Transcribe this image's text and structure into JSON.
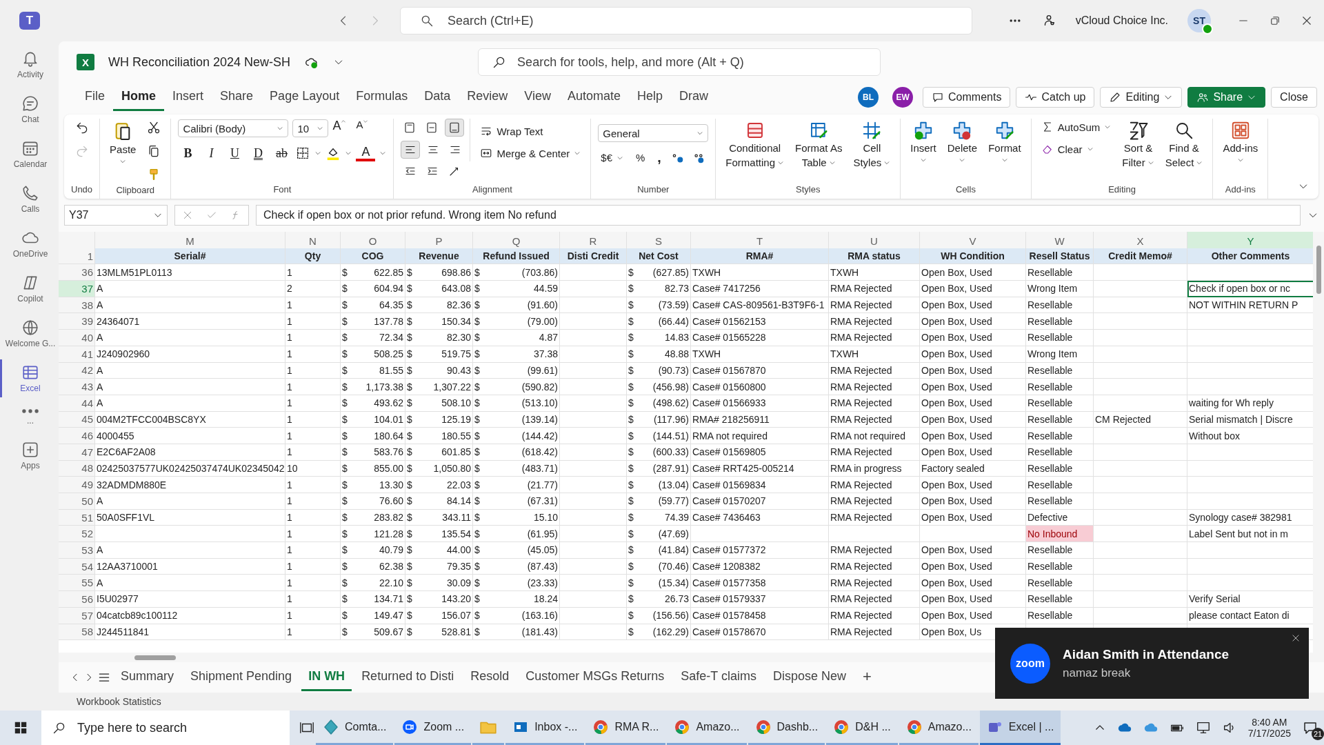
{
  "teams": {
    "logo": "T",
    "search": {
      "placeholder": "Search (Ctrl+E)"
    },
    "org": "vCloud Choice Inc.",
    "avatar": "ST"
  },
  "rail": [
    {
      "label": "Activity",
      "kind": "bell",
      "selected": false
    },
    {
      "label": "Chat",
      "kind": "chat",
      "selected": false
    },
    {
      "label": "Calendar",
      "kind": "calendar",
      "selected": false
    },
    {
      "label": "Calls",
      "kind": "phone",
      "selected": false
    },
    {
      "label": "OneDrive",
      "kind": "cloud",
      "selected": false
    },
    {
      "label": "Copilot",
      "kind": "copilot",
      "selected": false
    },
    {
      "label": "Welcome G...",
      "kind": "welcome",
      "selected": false
    },
    {
      "label": "Excel",
      "kind": "excel",
      "selected": true
    },
    {
      "label": "...",
      "kind": "more",
      "selected": false
    },
    {
      "label": "Apps",
      "kind": "apps",
      "selected": false
    }
  ],
  "excel": {
    "app_icon": "X",
    "title": "WH Reconciliation 2024 New-SH",
    "search": {
      "placeholder": "Search for tools, help, and more (Alt + Q)"
    },
    "menu": [
      {
        "label": "File",
        "selected": false
      },
      {
        "label": "Home",
        "selected": true
      },
      {
        "label": "Insert",
        "selected": false
      },
      {
        "label": "Share",
        "selected": false
      },
      {
        "label": "Page Layout",
        "selected": false
      },
      {
        "label": "Formulas",
        "selected": false
      },
      {
        "label": "Data",
        "selected": false
      },
      {
        "label": "Review",
        "selected": false
      },
      {
        "label": "View",
        "selected": false
      },
      {
        "label": "Automate",
        "selected": false
      },
      {
        "label": "Help",
        "selected": false
      },
      {
        "label": "Draw",
        "selected": false
      }
    ],
    "collaborators": [
      {
        "initials": "BL",
        "color": "#0f6cbd"
      },
      {
        "initials": "EW",
        "color": "#8a1fa8"
      }
    ],
    "buttons": [
      {
        "label": "Comments",
        "kind": "comments"
      },
      {
        "label": "Catch up",
        "kind": "catchup"
      },
      {
        "label": "Editing",
        "kind": "editing"
      },
      {
        "label": "Share",
        "kind": "share"
      },
      {
        "label": "Close",
        "kind": "close"
      }
    ]
  },
  "ribbon": {
    "undo": {
      "group": "Undo"
    },
    "clipboard": {
      "paste": "Paste",
      "group": "Clipboard"
    },
    "font": {
      "name": "Calibri (Body)",
      "size": "10",
      "grow": "A",
      "shrink": "A",
      "styles": [
        "B",
        "I",
        "U",
        "D",
        "ab"
      ],
      "color_letter": "A",
      "group": "Font"
    },
    "alignment": {
      "wrap": "Wrap Text",
      "merge": "Merge & Center",
      "group": "Alignment"
    },
    "number": {
      "format": "General",
      "currency": "$€",
      "percent": "%",
      "comma": ",",
      "group": "Number"
    },
    "styles": {
      "buttons": [
        {
          "lines": [
            "Conditional",
            "Formatting"
          ],
          "kind": "conditional"
        },
        {
          "lines": [
            "Format As",
            "Table"
          ],
          "kind": "table"
        },
        {
          "lines": [
            "Cell",
            "Styles"
          ],
          "kind": "cellstyles"
        }
      ],
      "group": "Styles"
    },
    "cells": {
      "buttons": [
        {
          "label": "Insert",
          "kind": "insert"
        },
        {
          "label": "Delete",
          "kind": "delete"
        },
        {
          "label": "Format",
          "kind": "format"
        }
      ],
      "group": "Cells"
    },
    "editing": {
      "autosum": "AutoSum",
      "clear": "Clear",
      "sort": [
        "Sort &",
        "Filter"
      ],
      "find": [
        "Find &",
        "Select"
      ],
      "group": "Editing"
    },
    "addins": {
      "button": "Add-ins",
      "group": "Add-ins"
    }
  },
  "formula_bar": {
    "name_box": "Y37",
    "formula": "Check if open box or not prior refund. Wrong item No refund"
  },
  "sheet": {
    "columns": [
      {
        "letter": "M",
        "selected": false
      },
      {
        "letter": "N",
        "selected": false
      },
      {
        "letter": "O",
        "selected": false
      },
      {
        "letter": "P",
        "selected": false
      },
      {
        "letter": "Q",
        "selected": false
      },
      {
        "letter": "R",
        "selected": false
      },
      {
        "letter": "S",
        "selected": false
      },
      {
        "letter": "T",
        "selected": false
      },
      {
        "letter": "U",
        "selected": false
      },
      {
        "letter": "V",
        "selected": false
      },
      {
        "letter": "W",
        "selected": false
      },
      {
        "letter": "X",
        "selected": false
      },
      {
        "letter": "Y",
        "selected": true
      }
    ],
    "header_row": {
      "row": "1",
      "cells": [
        "Serial#",
        "Qty",
        "COG",
        "Revenue",
        "Refund Issued",
        "Disti Credit",
        "Net Cost",
        "RMA#",
        "RMA status",
        "WH Condition",
        "Resell Status",
        "Credit Memo#",
        "Other Comments"
      ]
    },
    "rows": [
      {
        "row": "36",
        "selected": false,
        "serial": "13MLM51PL0113",
        "qty": "1",
        "cog": [
          "$",
          "622.85"
        ],
        "revenue": [
          "$",
          "698.86"
        ],
        "refund": [
          "$",
          "(703.86)"
        ],
        "net": [
          "$",
          "(627.85)"
        ],
        "rma": "TXWH",
        "rma_status": "TXWH",
        "wh_condition": "Open Box, Used",
        "resell": "Resellable",
        "resell_flagged": false
      },
      {
        "row": "37",
        "selected": true,
        "serial": "A",
        "qty": "2",
        "cog": [
          "$",
          "604.94"
        ],
        "revenue": [
          "$",
          "643.08"
        ],
        "refund": [
          "$",
          "44.59"
        ],
        "net": [
          "$",
          "82.73"
        ],
        "rma": "Case# 7417256",
        "rma_status": "RMA Rejected",
        "wh_condition": "Open Box, Used",
        "resell": "Wrong Item",
        "resell_flagged": false,
        "comment": "Check if open box or nc"
      },
      {
        "row": "38",
        "selected": false,
        "serial": "A",
        "qty": "1",
        "cog": [
          "$",
          "64.35"
        ],
        "revenue": [
          "$",
          "82.36"
        ],
        "refund": [
          "$",
          "(91.60)"
        ],
        "net": [
          "$",
          "(73.59)"
        ],
        "rma": "Case# CAS-809561-B3T9F6-1",
        "rma_status": "RMA Rejected",
        "wh_condition": "Open Box, Used",
        "resell": "Resellable",
        "resell_flagged": false,
        "comment": "NOT WITHIN RETURN P"
      },
      {
        "row": "39",
        "selected": false,
        "serial": "24364071",
        "qty": "1",
        "cog": [
          "$",
          "137.78"
        ],
        "revenue": [
          "$",
          "150.34"
        ],
        "refund": [
          "$",
          "(79.00)"
        ],
        "net": [
          "$",
          "(66.44)"
        ],
        "rma": "Case# 01562153",
        "rma_status": "RMA Rejected",
        "wh_condition": "Open Box, Used",
        "resell": "Resellable",
        "resell_flagged": false
      },
      {
        "row": "40",
        "selected": false,
        "serial": "A",
        "qty": "1",
        "cog": [
          "$",
          "72.34"
        ],
        "revenue": [
          "$",
          "82.30"
        ],
        "refund": [
          "$",
          "4.87"
        ],
        "net": [
          "$",
          "14.83"
        ],
        "rma": "Case# 01565228",
        "rma_status": "RMA Rejected",
        "wh_condition": "Open Box, Used",
        "resell": "Resellable",
        "resell_flagged": false
      },
      {
        "row": "41",
        "selected": false,
        "serial": "J240902960",
        "qty": "1",
        "cog": [
          "$",
          "508.25"
        ],
        "revenue": [
          "$",
          "519.75"
        ],
        "refund": [
          "$",
          "37.38"
        ],
        "net": [
          "$",
          "48.88"
        ],
        "rma": "TXWH",
        "rma_status": "TXWH",
        "wh_condition": "Open Box, Used",
        "resell": "Wrong Item",
        "resell_flagged": false
      },
      {
        "row": "42",
        "selected": false,
        "serial": "A",
        "qty": "1",
        "cog": [
          "$",
          "81.55"
        ],
        "revenue": [
          "$",
          "90.43"
        ],
        "refund": [
          "$",
          "(99.61)"
        ],
        "net": [
          "$",
          "(90.73)"
        ],
        "rma": "Case# 01567870",
        "rma_status": "RMA Rejected",
        "wh_condition": "Open Box, Used",
        "resell": "Resellable",
        "resell_flagged": false
      },
      {
        "row": "43",
        "selected": false,
        "serial": "A",
        "qty": "1",
        "cog": [
          "$",
          "1,173.38"
        ],
        "revenue": [
          "$",
          "1,307.22"
        ],
        "refund": [
          "$",
          "(590.82)"
        ],
        "net": [
          "$",
          "(456.98)"
        ],
        "rma": "Case# 01560800",
        "rma_status": "RMA Rejected",
        "wh_condition": "Open Box, Used",
        "resell": "Resellable",
        "resell_flagged": false
      },
      {
        "row": "44",
        "selected": false,
        "serial": "A",
        "qty": "1",
        "cog": [
          "$",
          "493.62"
        ],
        "revenue": [
          "$",
          "508.10"
        ],
        "refund": [
          "$",
          "(513.10)"
        ],
        "net": [
          "$",
          "(498.62)"
        ],
        "rma": "Case# 01566933",
        "rma_status": "RMA Rejected",
        "wh_condition": "Open Box, Used",
        "resell": "Resellable",
        "resell_flagged": false,
        "comment": "waiting for Wh reply"
      },
      {
        "row": "45",
        "selected": false,
        "serial": "004M2TFCC004BSC8YX",
        "qty": "1",
        "cog": [
          "$",
          "104.01"
        ],
        "revenue": [
          "$",
          "125.19"
        ],
        "refund": [
          "$",
          "(139.14)"
        ],
        "net": [
          "$",
          "(117.96)"
        ],
        "rma": "RMA# 218256911",
        "rma_status": "RMA Rejected",
        "wh_condition": "Open Box, Used",
        "resell": "Resellable",
        "resell_flagged": false,
        "credit_memo": "CM Rejected",
        "comment": "Serial mismatch | Discre"
      },
      {
        "row": "46",
        "selected": false,
        "serial": "4000455",
        "qty": "1",
        "cog": [
          "$",
          "180.64"
        ],
        "revenue": [
          "$",
          "180.55"
        ],
        "refund": [
          "$",
          "(144.42)"
        ],
        "net": [
          "$",
          "(144.51)"
        ],
        "rma": "RMA not required",
        "rma_status": "RMA not required",
        "wh_condition": "Open Box, Used",
        "resell": "Resellable",
        "resell_flagged": false,
        "comment": "Without box"
      },
      {
        "row": "47",
        "selected": false,
        "serial": "E2C6AF2A08",
        "qty": "1",
        "cog": [
          "$",
          "583.76"
        ],
        "revenue": [
          "$",
          "601.85"
        ],
        "refund": [
          "$",
          "(618.42)"
        ],
        "net": [
          "$",
          "(600.33)"
        ],
        "rma": "Case# 01569805",
        "rma_status": "RMA Rejected",
        "wh_condition": "Open Box, Used",
        "resell": "Resellable",
        "resell_flagged": false
      },
      {
        "row": "48",
        "selected": false,
        "serial": "02425037577UK02425037474UK02345042",
        "qty": "10",
        "cog": [
          "$",
          "855.00"
        ],
        "revenue": [
          "$",
          "1,050.80"
        ],
        "refund": [
          "$",
          "(483.71)"
        ],
        "net": [
          "$",
          "(287.91)"
        ],
        "rma": "Case# RRT425-005214",
        "rma_status": "RMA in progress",
        "wh_condition": "Factory sealed",
        "resell": "Resellable",
        "resell_flagged": false
      },
      {
        "row": "49",
        "selected": false,
        "serial": "32ADMDM880E",
        "qty": "1",
        "cog": [
          "$",
          "13.30"
        ],
        "revenue": [
          "$",
          "22.03"
        ],
        "refund": [
          "$",
          "(21.77)"
        ],
        "net": [
          "$",
          "(13.04)"
        ],
        "rma": "Case# 01569834",
        "rma_status": "RMA Rejected",
        "wh_condition": "Open Box, Used",
        "resell": "Resellable",
        "resell_flagged": false
      },
      {
        "row": "50",
        "selected": false,
        "serial": "A",
        "qty": "1",
        "cog": [
          "$",
          "76.60"
        ],
        "revenue": [
          "$",
          "84.14"
        ],
        "refund": [
          "$",
          "(67.31)"
        ],
        "net": [
          "$",
          "(59.77)"
        ],
        "rma": "Case# 01570207",
        "rma_status": "RMA Rejected",
        "wh_condition": "Open Box, Used",
        "resell": "Resellable",
        "resell_flagged": false
      },
      {
        "row": "51",
        "selected": false,
        "serial": "50A0SFF1VL",
        "qty": "1",
        "cog": [
          "$",
          "283.82"
        ],
        "revenue": [
          "$",
          "343.11"
        ],
        "refund": [
          "$",
          "15.10"
        ],
        "net": [
          "$",
          "74.39"
        ],
        "rma": "Case# 7436463",
        "rma_status": "RMA Rejected",
        "wh_condition": "Open Box, Used",
        "resell": "Defective",
        "resell_flagged": false,
        "comment": "Synology case# 382981"
      },
      {
        "row": "52",
        "selected": false,
        "qty": "1",
        "cog": [
          "$",
          "121.28"
        ],
        "revenue": [
          "$",
          "135.54"
        ],
        "refund": [
          "$",
          "(61.95)"
        ],
        "net": [
          "$",
          "(47.69)"
        ],
        "resell": "No Inbound",
        "resell_flagged": true,
        "comment": "Label Sent but not in m"
      },
      {
        "row": "53",
        "selected": false,
        "serial": "A",
        "qty": "1",
        "cog": [
          "$",
          "40.79"
        ],
        "revenue": [
          "$",
          "44.00"
        ],
        "refund": [
          "$",
          "(45.05)"
        ],
        "net": [
          "$",
          "(41.84)"
        ],
        "rma": "Case# 01577372",
        "rma_status": "RMA Rejected",
        "wh_condition": "Open Box, Used",
        "resell": "Resellable",
        "resell_flagged": false
      },
      {
        "row": "54",
        "selected": false,
        "serial": "12AA3710001",
        "qty": "1",
        "cog": [
          "$",
          "62.38"
        ],
        "revenue": [
          "$",
          "79.35"
        ],
        "refund": [
          "$",
          "(87.43)"
        ],
        "net": [
          "$",
          "(70.46)"
        ],
        "rma": "Case# 1208382",
        "rma_status": "RMA Rejected",
        "wh_condition": "Open Box, Used",
        "resell": "Resellable",
        "resell_flagged": false
      },
      {
        "row": "55",
        "selected": false,
        "serial": "A",
        "qty": "1",
        "cog": [
          "$",
          "22.10"
        ],
        "revenue": [
          "$",
          "30.09"
        ],
        "refund": [
          "$",
          "(23.33)"
        ],
        "net": [
          "$",
          "(15.34)"
        ],
        "rma": "Case# 01577358",
        "rma_status": "RMA Rejected",
        "wh_condition": "Open Box, Used",
        "resell": "Resellable",
        "resell_flagged": false
      },
      {
        "row": "56",
        "selected": false,
        "serial": "I5U02977",
        "qty": "1",
        "cog": [
          "$",
          "134.71"
        ],
        "revenue": [
          "$",
          "143.20"
        ],
        "refund": [
          "$",
          "18.24"
        ],
        "net": [
          "$",
          "26.73"
        ],
        "rma": "Case# 01579337",
        "rma_status": "RMA Rejected",
        "wh_condition": "Open Box, Used",
        "resell": "Resellable",
        "resell_flagged": false,
        "comment": "Verify Serial"
      },
      {
        "row": "57",
        "selected": false,
        "serial": "04catcb89c100112",
        "qty": "1",
        "cog": [
          "$",
          "149.47"
        ],
        "revenue": [
          "$",
          "156.07"
        ],
        "refund": [
          "$",
          "(163.16)"
        ],
        "net": [
          "$",
          "(156.56)"
        ],
        "rma": "Case# 01578458",
        "rma_status": "RMA Rejected",
        "wh_condition": "Open Box, Used",
        "resell": "Resellable",
        "resell_flagged": false,
        "comment": "please contact Eaton di"
      },
      {
        "row": "58",
        "selected": false,
        "serial": "J244511841",
        "qty": "1",
        "cog": [
          "$",
          "509.67"
        ],
        "revenue": [
          "$",
          "528.81"
        ],
        "refund": [
          "$",
          "(181.43)"
        ],
        "net": [
          "$",
          "(162.29)"
        ],
        "rma": "Case# 01578670",
        "rma_status": "RMA Rejected",
        "wh_condition": "Open Box, Us",
        "resell_flagged": false
      }
    ]
  },
  "sheet_tabs": [
    {
      "label": "Summary",
      "selected": false
    },
    {
      "label": "Shipment Pending",
      "selected": false
    },
    {
      "label": "IN WH",
      "selected": true
    },
    {
      "label": "Returned to Disti",
      "selected": false
    },
    {
      "label": "Resold",
      "selected": false
    },
    {
      "label": "Customer MSGs Returns",
      "selected": false
    },
    {
      "label": "Safe-T claims",
      "selected": false
    },
    {
      "label": "Dispose New",
      "selected": false
    }
  ],
  "add_sheet": "+",
  "status_bar": {
    "text": "Workbook Statistics"
  },
  "toast": {
    "logo": "zoom",
    "title": "Aidan Smith in Attendance",
    "message": "namaz break"
  },
  "taskbar": {
    "search": {
      "placeholder": "Type here to search"
    },
    "apps": [
      {
        "label": "Comta...",
        "kind": "comta",
        "selected": false
      },
      {
        "label": "Zoom ...",
        "kind": "zoom",
        "selected": false
      },
      {
        "kind": "folder",
        "selected": false
      },
      {
        "label": "Inbox -...",
        "kind": "outlook",
        "selected": false
      },
      {
        "label": "RMA R...",
        "kind": "chrome",
        "selected": false
      },
      {
        "label": "Amazo...",
        "kind": "chrome",
        "selected": false
      },
      {
        "label": "Dashb...",
        "kind": "chrome",
        "selected": false
      },
      {
        "label": "D&H ...",
        "kind": "chrome",
        "selected": false
      },
      {
        "label": "Amazo...",
        "kind": "chrome",
        "selected": false
      },
      {
        "label": "Excel | ...",
        "kind": "teams",
        "selected": true
      }
    ],
    "time": "8:40 AM",
    "date": "7/17/2025",
    "notifications": "21"
  }
}
